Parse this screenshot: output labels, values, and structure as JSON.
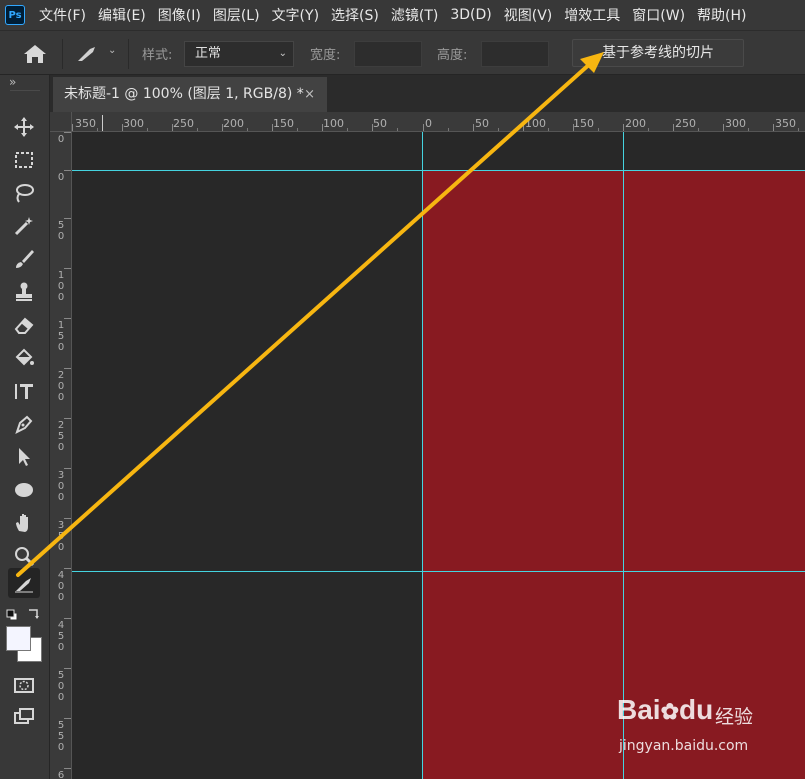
{
  "app": {
    "logo_text": "Ps"
  },
  "menu": [
    "文件(F)",
    "编辑(E)",
    "图像(I)",
    "图层(L)",
    "文字(Y)",
    "选择(S)",
    "滤镜(T)",
    "3D(D)",
    "视图(V)",
    "增效工具",
    "窗口(W)",
    "帮助(H)"
  ],
  "options_bar": {
    "style_label": "样式:",
    "style_value": "正常",
    "width_label": "宽度:",
    "height_label": "高度:",
    "slice_button": "基于参考线的切片"
  },
  "toolbar": {
    "collapse_glyph": "»",
    "tools": [
      "move-icon",
      "marquee-icon",
      "lasso-icon",
      "magic-wand-icon",
      "brush-icon",
      "stamp-icon",
      "eraser-icon",
      "paint-bucket-icon",
      "type-icon",
      "pen-icon",
      "path-select-icon",
      "ellipse-icon",
      "hand-icon",
      "zoom-icon",
      "slice-icon"
    ],
    "active_tool": "slice-icon"
  },
  "document_tab": {
    "title": "未标题-1 @ 100% (图层 1, RGB/8) *",
    "close": "×"
  },
  "rulers": {
    "horizontal": [
      "350",
      "300",
      "250",
      "200",
      "150",
      "100",
      "50",
      "0",
      "50",
      "100",
      "150",
      "200",
      "250",
      "300",
      "350"
    ],
    "vertical": [
      "0",
      "0",
      "50",
      "100",
      "150",
      "200",
      "250",
      "300",
      "350",
      "400",
      "450",
      "500",
      "550",
      "6"
    ]
  },
  "colors": {
    "canvas_fill": "#881a21",
    "guide": "#45d4e0",
    "arrow": "#f7b611",
    "workspace": "#282828"
  },
  "watermark": {
    "brand": "Bai",
    "brand_suffix": "du",
    "sub": "经验",
    "url": "jingyan.baidu.com"
  }
}
